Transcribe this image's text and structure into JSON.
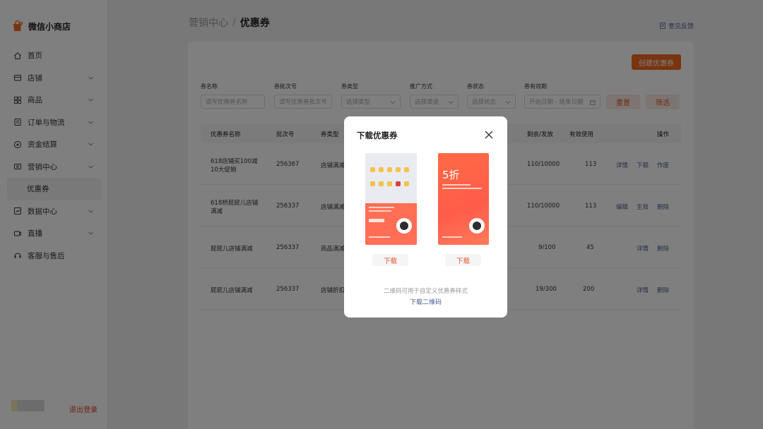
{
  "app": {
    "title": "微信小商店"
  },
  "sidebar": {
    "items": [
      {
        "label": "首页",
        "icon": "home-icon",
        "has_children": false
      },
      {
        "label": "店铺",
        "icon": "store-icon",
        "has_children": true
      },
      {
        "label": "商品",
        "icon": "grid-icon",
        "has_children": true
      },
      {
        "label": "订单与物流",
        "icon": "order-icon",
        "has_children": true
      },
      {
        "label": "资金结算",
        "icon": "money-icon",
        "has_children": true
      },
      {
        "label": "营销中心",
        "icon": "marketing-icon",
        "has_children": true
      },
      {
        "label": "优惠券",
        "icon": "",
        "has_children": false,
        "active": true
      },
      {
        "label": "数据中心",
        "icon": "chart-icon",
        "has_children": true
      },
      {
        "label": "直播",
        "icon": "live-icon",
        "has_children": true
      },
      {
        "label": "客服与售后",
        "icon": "service-icon",
        "has_children": false
      }
    ],
    "logout_label": "退出登录"
  },
  "header": {
    "breadcrumb_parent": "营销中心",
    "breadcrumb_sep": "/",
    "breadcrumb_current": "优惠券",
    "feedback_label": "意见反馈"
  },
  "toolbar": {
    "create_label": "创建优惠券"
  },
  "filters": {
    "name": {
      "label": "券名称",
      "placeholder": "请写优惠券名称"
    },
    "batch": {
      "label": "券批次号",
      "placeholder": "请写优惠券批次号"
    },
    "type": {
      "label": "券类型",
      "placeholder": "选择类型"
    },
    "promo": {
      "label": "推广方式",
      "placeholder": "选择渠道"
    },
    "status": {
      "label": "券状态",
      "placeholder": "选择状态"
    },
    "period": {
      "label": "券有效期",
      "placeholder": "开始日期 - 结束日期"
    },
    "reset_label": "重置",
    "filter_label": "筛选"
  },
  "table": {
    "headers": [
      "优惠券名称",
      "批次号",
      "券类型",
      "剩余/发放",
      "有效使用",
      "操作"
    ],
    "rows": [
      {
        "name1": "618店铺买100减",
        "name2": "10大促销",
        "batch": "256367",
        "type": "店铺满减",
        "remain": "110/10000",
        "used": "113",
        "actions": [
          "详情",
          "下载",
          "作废"
        ]
      },
      {
        "name1": "618桥屁屁儿店铺",
        "name2": "满减",
        "batch": "256337",
        "type": "店铺满减",
        "remain": "110/10000",
        "used": "113",
        "actions": [
          "编辑",
          "生效",
          "删除"
        ]
      },
      {
        "name1": "屁屁儿店铺满减",
        "name2": "",
        "batch": "256337",
        "type": "商品满减",
        "remain": "9/100",
        "used": "45",
        "actions": [
          "详情",
          "删除"
        ]
      },
      {
        "name1": "屁屁儿店铺满减",
        "name2": "",
        "batch": "256337",
        "type": "店铺折扣",
        "remain": "19/300",
        "used": "200",
        "actions": [
          "详情",
          "删除"
        ]
      }
    ]
  },
  "modal": {
    "title": "下载优惠券",
    "poster2_big": "5折",
    "download_label": "下载",
    "hint": "二维码可用于自定义优惠券样式",
    "download_qr_label": "下载二维码"
  },
  "colors": {
    "accent": "#f16a1e",
    "link": "#4a5f8c",
    "danger": "#e65b2b"
  }
}
